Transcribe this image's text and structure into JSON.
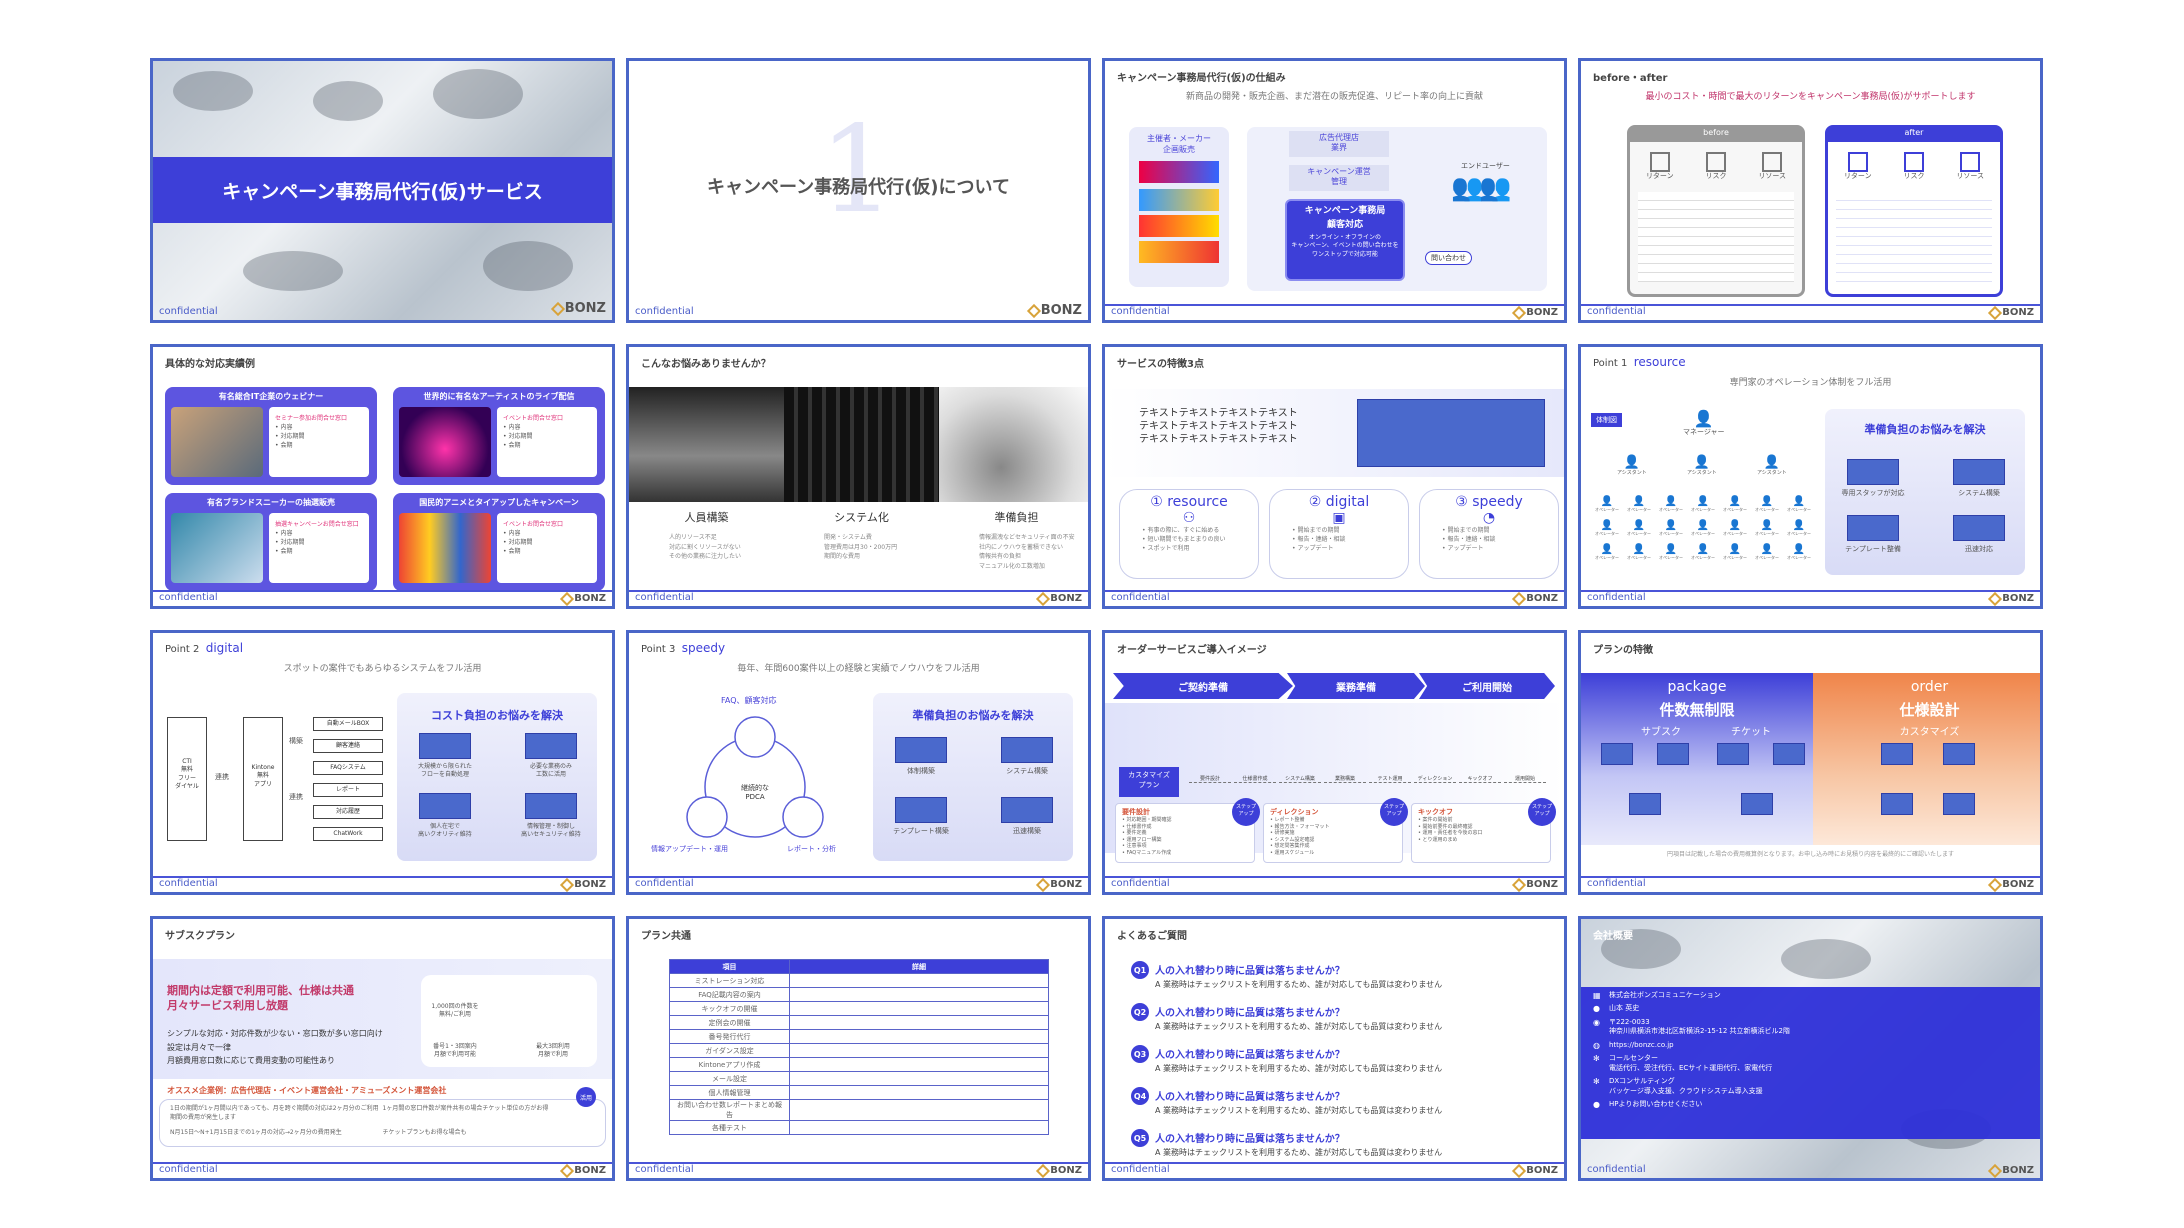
{
  "common": {
    "confidential": "confidential",
    "logo": "BONZ"
  },
  "s1": {
    "title": "キャンペーン事務局代行(仮)サービス"
  },
  "s2": {
    "number": "1",
    "title": "キャンペーン事務局代行(仮)について"
  },
  "s3": {
    "title": "キャンペーン事務局代行(仮)の仕組み",
    "sub": "新商品の開発・販売企画、まだ潜在の販売促進、リピート率の向上に貢献",
    "client": "主催者・メーカー\n企画販売",
    "agency": "広告代理店\n業界",
    "ops": "キャンペーン運営\n管理",
    "office": "キャンペーン事務局\n顧客対応",
    "office_sub": "オンライン・オフラインの\nキャンペーン、イベントの問い合わせを\nワンストップで対応可能",
    "enduser": "エンドユーザー",
    "inquiry": "問い合わせ"
  },
  "s4": {
    "title": "before・after",
    "sub": "最小のコスト・時間で最大のリターンをキャンペーン事務局(仮)がサポートします",
    "before": "before",
    "after": "after",
    "labels": [
      "リターン",
      "リスク",
      "リソース"
    ],
    "labels_after": [
      "リターン",
      "リスク",
      "リソース"
    ]
  },
  "s5": {
    "title": "具体的な対応実績例",
    "cards": [
      {
        "title": "有名総合IT企業のウェビナー",
        "label": "セミナー参加お問合せ窓口",
        "items": [
          "内容",
          "対応期間",
          "会期"
        ]
      },
      {
        "title": "世界的に有名なアーティストのライブ配信",
        "label": "イベントお問合せ窓口",
        "items": [
          "内容",
          "対応期間",
          "会期"
        ]
      },
      {
        "title": "有名ブランドスニーカーの抽選販売",
        "label": "抽選キャンペーンお問合せ窓口",
        "items": [
          "内容",
          "対応期間",
          "会期"
        ]
      },
      {
        "title": "国民的アニメとタイアップしたキャンペーン",
        "label": "イベントお問合せ窓口",
        "items": [
          "内容",
          "対応期間",
          "会期"
        ]
      }
    ]
  },
  "s6": {
    "title": "こんなお悩みありませんか？",
    "cols": [
      {
        "head": "人員構築",
        "lines": [
          "人的リソース不足",
          "対応に割くリソースがない",
          "その他の業務に注力したい"
        ]
      },
      {
        "head": "システム化",
        "lines": [
          "開発・システム費",
          "管理費用は月30・200万円",
          "期間的な費用"
        ]
      },
      {
        "head": "準備負担",
        "lines": [
          "情報漏洩などセキュリティ面の不安",
          "社内にノウハウを蓄積できない",
          "情報共有の負担",
          "マニュアル化の工数増加"
        ]
      }
    ]
  },
  "s7": {
    "title": "サービスの特徴3点",
    "text": [
      "テキストテキストテキストテキスト",
      "テキストテキストテキストテキスト",
      "テキストテキストテキストテキスト"
    ],
    "features": [
      {
        "num": "①",
        "name": "resource",
        "lines": [
          "有事の際に、すぐに始める",
          "短い期間でもまとまりの良い",
          "スポットで利用"
        ]
      },
      {
        "num": "②",
        "name": "digital",
        "lines": [
          "開始までの期間",
          "報告・連絡・相談",
          "アップデート"
        ]
      },
      {
        "num": "③",
        "name": "speedy",
        "lines": [
          "開始までの期間",
          "報告・連絡・相談",
          "アップデート"
        ]
      }
    ]
  },
  "s8": {
    "point": "Point 1",
    "name": "resource",
    "sub": "専門家のオペレーション体制をフル活用",
    "badge": "体制図",
    "head": "準備負担のお悩みを解決",
    "top": "マネージャー",
    "mid": "アシスタント",
    "low": "オペレーター",
    "boxes": [
      "専用スタッフが対応",
      "システム構築",
      "テンプレート整備",
      "迅速対応"
    ]
  },
  "s9": {
    "point": "Point 2",
    "name": "digital",
    "sub": "スポットの案件でもあらゆるシステムをフル活用",
    "head": "コスト負担のお悩みを解決",
    "left1": "CTI\n無料\nフリー\nダイヤル",
    "mid1": "連携",
    "mid2": "Kintone\n無料\nアプリ",
    "side1": "構築",
    "side2": "連携",
    "items": [
      "自動メールBOX",
      "顧客連絡",
      "FAQシステム",
      "レポート",
      "対応履歴",
      "ChatWork"
    ],
    "boxes": [
      "大規模から限られた\nフローを自動処理",
      "必要な業務のみ\n工数に活用",
      "個人在宅で\n高いクオリティ維持",
      "情報管理・制御し\n高いセキュリティ維持"
    ]
  },
  "s10": {
    "point": "Point 3",
    "name": "speedy",
    "sub": "毎年、年間600案件以上の経験と実績でノウハウをフル活用",
    "head": "準備負担のお悩みを解決",
    "faq": "FAQ、顧客対応",
    "center": "継続的な\nPDCA",
    "left": "情報アップデート・運用",
    "right": "レポート・分析",
    "boxes": [
      "体制構築",
      "システム構築",
      "テンプレート構築",
      "迅速構築"
    ]
  },
  "s11": {
    "title": "オーダーサービスご導入イメージ",
    "steps": [
      "ご契約準備",
      "業務準備",
      "ご利用開始"
    ],
    "badge": "カスタマイズ\nプラン",
    "tl": [
      "要件設計",
      "仕様書作成",
      "システム構築",
      "業務構築",
      "テスト運用",
      "ディレクション",
      "キックオフ",
      "運用開始"
    ],
    "cards": [
      {
        "t": "要件設計",
        "l": [
          "対応範囲・期間確認",
          "仕様書作成",
          "要件定義",
          "運用フロー構築",
          "注意事項",
          "FAQマニュアル作成",
          "部門設計"
        ]
      },
      {
        "t": "ディレクション",
        "l": [
          "レポート整備",
          "報告方法・フォーマット",
          "研修実施",
          "システム設定確認",
          "想定問答集作成",
          "運用スケジュール"
        ]
      },
      {
        "t": "キックオフ",
        "l": [
          "案件の開始前",
          "開始前要件の最終確認",
          "運用・責任者を今後の窓口",
          "とり運用のまめ"
        ]
      }
    ],
    "tag": "ステップ\nアップ"
  },
  "s12": {
    "title": "プランの特徴",
    "pkg": "package",
    "pkg_head": "件数無制限",
    "pkg_sub1": "サブスク",
    "pkg_sub2": "チケット",
    "ord": "order",
    "ord_head": "仕様設計",
    "ord_sub": "カスタマイズ",
    "note": "円項目は記載した場合の費用概算例となります。お申し込み時にお見積り内容を最終的にご確認いたします"
  },
  "s13": {
    "title": "サブスクプラン",
    "head1": "期間内は定額で利用可能、仕様は共通",
    "head2": "月々サービス利用し放題",
    "lines": [
      "シンプルな対応・対応件数が少ない・窓口数が多い窓口向け",
      "設定は月々で一律",
      "月額費用窓口数に応じて費用変動の可能性あり"
    ],
    "icons": [
      "1,000回の件数を\n無料/ご利用",
      "",
      "",
      "",
      "番号1・3回案内\n月額で利用可能",
      "最大3回利用\n月額で利用"
    ],
    "rec": "オススメ企業例：広告代理店・イベント運営会社・アミューズメント運営会社",
    "badge": "活用",
    "notes": [
      "1日の期間が1ヶ月間以内であっても、月を跨ぐ期間の対応は2ヶ月分のご利用期間の費用が発生します",
      "N月15日〜N+1月15日までの1ヶ月の対応→2ヶ月分の費用発生",
      "1ヶ月間の窓口件数が案件共有の場合チケット単位の方がお得",
      "チケットプランもお得な場合も"
    ]
  },
  "s14": {
    "title": "プラン共通",
    "h1": "項目",
    "h2": "詳細",
    "rows": [
      "ミストレーション対応",
      "FAQ記載内容の案内",
      "キックオフの開催",
      "定例会の開催",
      "番号発行代行",
      "ガイダンス設定",
      "Kintoneアプリ作成",
      "メール設定",
      "個人情報管理",
      "お問い合わせ数レポートまとめ報告",
      "各種テスト"
    ]
  },
  "s15": {
    "title": "よくあるご質問",
    "qa": [
      {
        "n": "Q1",
        "q": "人の入れ替わり時に品質は落ちませんか？",
        "a": "A 業務時はチェックリストを利用するため、誰が対応しても品質は変わりません"
      },
      {
        "n": "Q2",
        "q": "人の入れ替わり時に品質は落ちませんか？",
        "a": "A 業務時はチェックリストを利用するため、誰が対応しても品質は変わりません"
      },
      {
        "n": "Q3",
        "q": "人の入れ替わり時に品質は落ちませんか？",
        "a": "A 業務時はチェックリストを利用するため、誰が対応しても品質は変わりません"
      },
      {
        "n": "Q4",
        "q": "人の入れ替わり時に品質は落ちませんか？",
        "a": "A 業務時はチェックリストを利用するため、誰が対応しても品質は変わりません"
      },
      {
        "n": "Q5",
        "q": "人の入れ替わり時に品質は落ちませんか？",
        "a": "A 業務時はチェックリストを利用するため、誰が対応しても品質は変わりません"
      }
    ]
  },
  "s16": {
    "title": "会社概要",
    "rows": [
      {
        "icon": "building-icon",
        "t": "株式会社ボンズコミュニケーション"
      },
      {
        "icon": "person-icon",
        "t": "山本 英史"
      },
      {
        "icon": "pin-icon",
        "t": "〒222-0033\n神奈川県横浜市港北区新横浜2-15-12 共立新横浜ビル2階"
      },
      {
        "icon": "globe-icon",
        "t": "https://bonzc.co.jp"
      },
      {
        "icon": "gear-icon",
        "t": "コールセンター\n電話代行、受注代行、ECサイト運用代行、家電代行"
      },
      {
        "icon": "gear-icon",
        "t": "DXコンサルティング\nバッケージ導入支援、クラウドシステム導入支援"
      },
      {
        "icon": "person-icon",
        "t": "HPよりお問い合わせください"
      }
    ]
  }
}
